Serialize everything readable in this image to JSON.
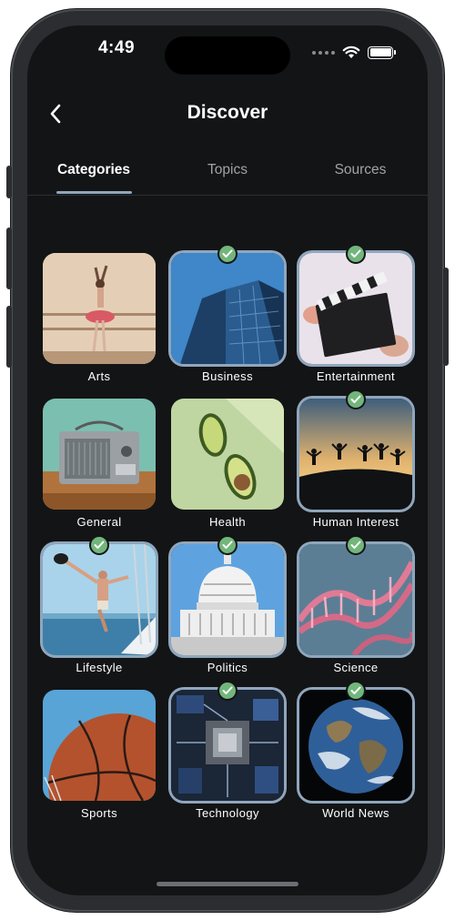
{
  "status_bar": {
    "time": "4:49"
  },
  "header": {
    "title": "Discover"
  },
  "tabs": [
    {
      "label": "Categories",
      "active": true
    },
    {
      "label": "Topics",
      "active": false
    },
    {
      "label": "Sources",
      "active": false
    }
  ],
  "categories": [
    {
      "label": "Arts",
      "selected": false,
      "icon": "ballet-dancer-image"
    },
    {
      "label": "Business",
      "selected": true,
      "icon": "office-building-image"
    },
    {
      "label": "Entertainment",
      "selected": true,
      "icon": "clapperboard-image"
    },
    {
      "label": "General",
      "selected": false,
      "icon": "radio-image"
    },
    {
      "label": "Health",
      "selected": false,
      "icon": "avocado-image"
    },
    {
      "label": "Human Interest",
      "selected": true,
      "icon": "people-jumping-image"
    },
    {
      "label": "Lifestyle",
      "selected": true,
      "icon": "sailboat-image"
    },
    {
      "label": "Politics",
      "selected": true,
      "icon": "capitol-image"
    },
    {
      "label": "Science",
      "selected": true,
      "icon": "dna-image"
    },
    {
      "label": "Sports",
      "selected": false,
      "icon": "basketball-image"
    },
    {
      "label": "Technology",
      "selected": true,
      "icon": "circuit-board-image"
    },
    {
      "label": "World News",
      "selected": true,
      "icon": "earth-image"
    }
  ],
  "colors": {
    "background": "#131416",
    "accent": "#8fa6bd",
    "check": "#72b67b"
  }
}
